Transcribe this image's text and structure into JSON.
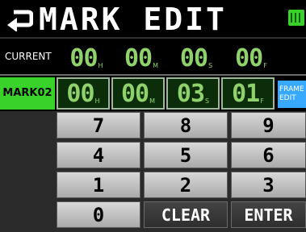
{
  "header": {
    "title": "MARK EDIT",
    "battery_color": "#39d22a"
  },
  "current": {
    "label": "CURRENT",
    "hours": "00",
    "minutes": "00",
    "seconds": "00",
    "frames": "00",
    "unit_h": "H",
    "unit_m": "M",
    "unit_s": "S",
    "unit_f": "F"
  },
  "mark": {
    "label": "MARK02",
    "hours": "00",
    "minutes": "00",
    "seconds": "03",
    "frames": "01",
    "unit_h": "H",
    "unit_m": "M",
    "unit_s": "S",
    "unit_f": "F",
    "frame_edit_line1": "FRAME",
    "frame_edit_line2": "EDIT",
    "accent": "#39d22a"
  },
  "keypad": {
    "k7": "7",
    "k8": "8",
    "k9": "9",
    "k4": "4",
    "k5": "5",
    "k6": "6",
    "k1": "1",
    "k2": "2",
    "k3": "3",
    "k0": "0",
    "clear": "CLEAR",
    "enter": "ENTER"
  }
}
